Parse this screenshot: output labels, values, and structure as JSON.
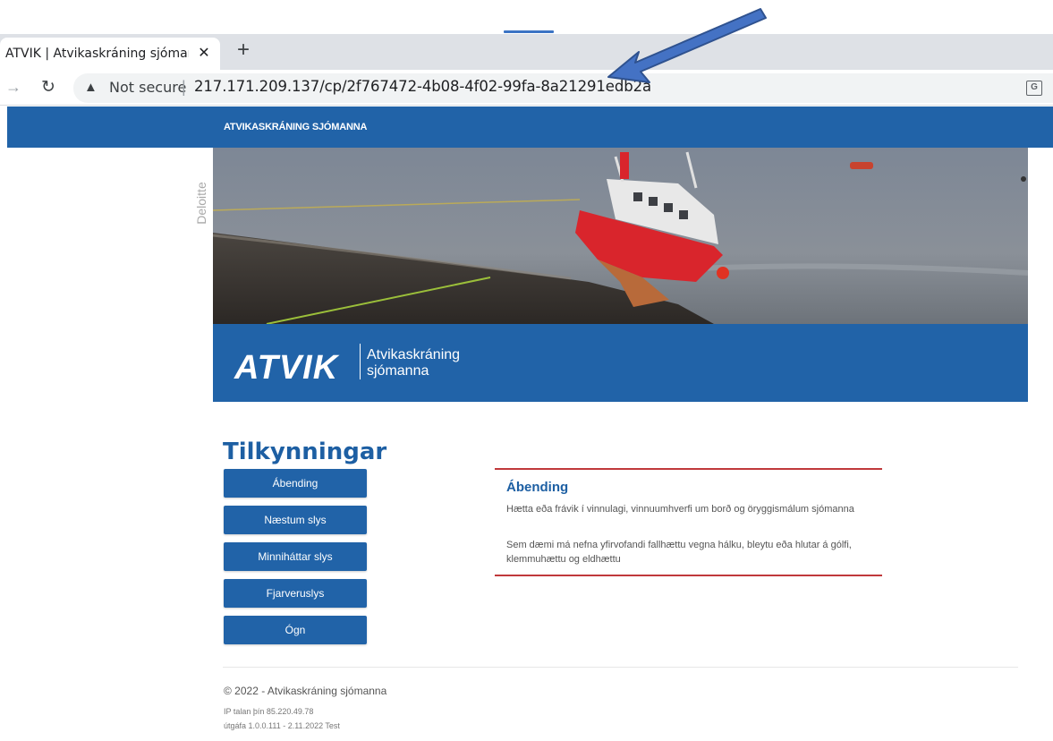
{
  "browser": {
    "tab_title": "ATVIK | Atvikaskráning sjómanna",
    "tab_close_icon": "close-icon",
    "new_tab_icon": "plus-icon",
    "security_label": "Not secure",
    "url": "217.171.209.137/cp/2f767472-4b08-4f02-99fa-8a21291edb2a"
  },
  "site": {
    "header_title": "ATVIKASKRÁNING SJÓMANNA",
    "side_brand": "Deloitte",
    "logo_text": "ATVIK",
    "logo_sub_line1": "Atvikaskráning",
    "logo_sub_line2": "sjómanna"
  },
  "main": {
    "heading": "Tilkynningar",
    "buttons": [
      {
        "label": "Ábending"
      },
      {
        "label": "Næstum slys"
      },
      {
        "label": "Minniháttar slys"
      },
      {
        "label": "Fjarveruslys"
      },
      {
        "label": "Ógn"
      }
    ],
    "panel": {
      "title": "Ábending",
      "paragraph1": "Hætta eða frávik í vinnulagi, vinnuumhverfi um borð og öryggismálum sjómanna",
      "paragraph2": "Sem dæmi má nefna yfirvofandi fallhættu vegna hálku, bleytu eða hlutar á gólfi, klemmuhættu og eldhættu"
    }
  },
  "footer": {
    "copyright": "© 2022 - Atvikaskráning sjómanna",
    "ip_line": "IP talan þín 85.220.49.78",
    "version_line": "útgáfa 1.0.0.111 - 2.11.2022 Test"
  },
  "colors": {
    "brand_blue": "#2163a8",
    "accent_red": "#c0393b",
    "annotation_arrow": "#4472c4"
  }
}
